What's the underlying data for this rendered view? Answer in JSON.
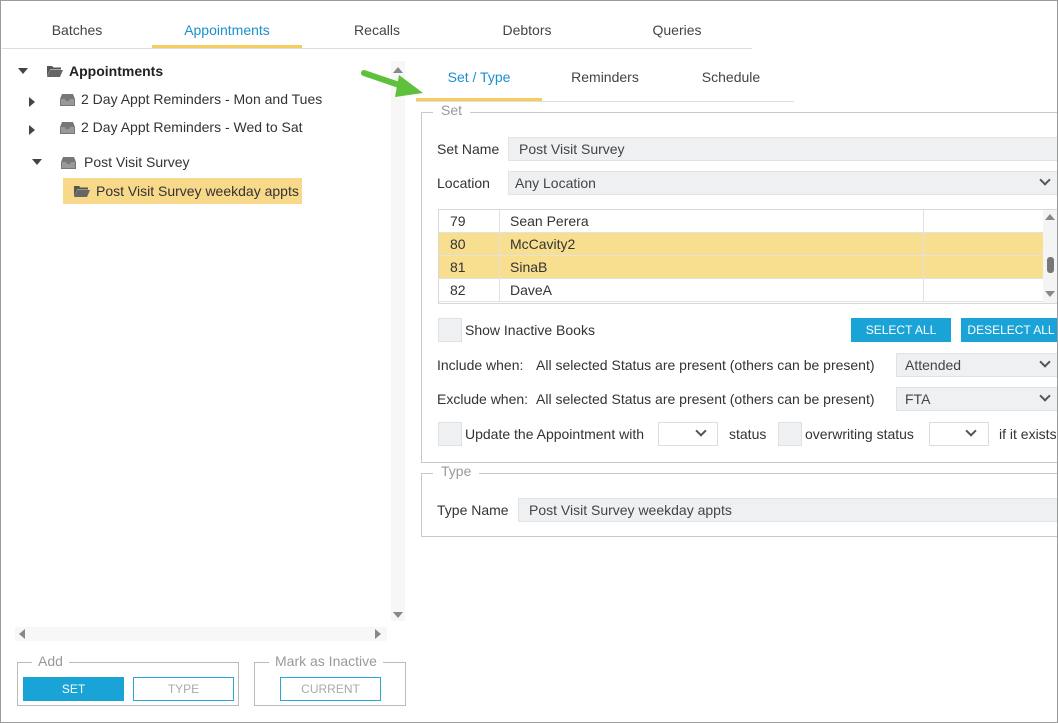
{
  "top_tabs": [
    "Batches",
    "Appointments",
    "Recalls",
    "Debtors",
    "Queries"
  ],
  "tree": {
    "root": "Appointments",
    "items": [
      "2 Day Appt Reminders - Mon and Tues",
      "2 Day Appt Reminders - Wed to Sat",
      "Post Visit Survey"
    ],
    "child": "Post Visit Survey weekday appts"
  },
  "add_group": {
    "legend": "Add",
    "set_button": "SET",
    "type_button": "TYPE"
  },
  "inactive_group": {
    "legend": "Mark as Inactive",
    "current_button": "CURRENT"
  },
  "sub_tabs": [
    "Set / Type",
    "Reminders",
    "Schedule"
  ],
  "set_panel": {
    "legend": "Set",
    "set_name_label": "Set Name",
    "set_name_value": "Post Visit Survey",
    "location_label": "Location",
    "location_value": "Any Location",
    "books": [
      {
        "num": "79",
        "name": "Sean Perera",
        "selected": false
      },
      {
        "num": "80",
        "name": "McCavity2",
        "selected": true
      },
      {
        "num": "81",
        "name": "SinaB",
        "selected": true
      },
      {
        "num": "82",
        "name": "DaveA",
        "selected": false
      }
    ],
    "show_inactive_label": "Show Inactive Books",
    "select_all": "SELECT ALL",
    "deselect_all": "DESELECT ALL",
    "include_label": "Include when:",
    "include_desc": "All selected Status are present (others can be present)",
    "include_value": "Attended",
    "exclude_label": "Exclude when:",
    "exclude_desc": "All selected Status are present (others can be present)",
    "exclude_value": "FTA",
    "update_label": "Update the Appointment with",
    "status_label": "status",
    "overwriting_label": "overwriting status",
    "if_exists_label": "if it exists"
  },
  "type_panel": {
    "legend": "Type",
    "type_name_label": "Type Name",
    "type_name_value": "Post Visit Survey weekday appts"
  },
  "colors": {
    "accent_blue": "#1aa3d6",
    "tab_active_text": "#1a8fd0",
    "tab_underline": "#f5cc5e",
    "selection": "#f8d98a",
    "arrow_green": "#5fc13b"
  }
}
